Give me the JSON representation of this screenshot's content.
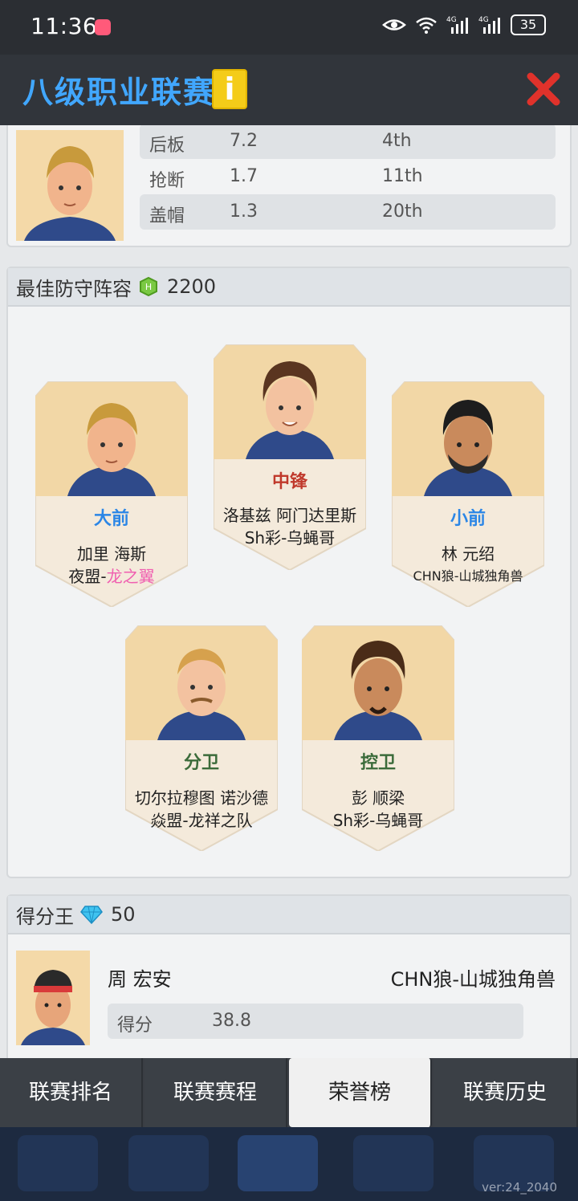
{
  "status_bar": {
    "time": "11:36",
    "battery": "35",
    "net1": "4G",
    "net2": "4G"
  },
  "header": {
    "title": "八级职业联赛",
    "info_label": "i"
  },
  "top_player": {
    "stats": [
      {
        "label": "后板",
        "value": "7.2",
        "rank": "4th"
      },
      {
        "label": "抢断",
        "value": "1.7",
        "rank": "11th"
      },
      {
        "label": "盖帽",
        "value": "1.3",
        "rank": "20th"
      }
    ]
  },
  "defense": {
    "title": "最佳防守阵容",
    "value": "2200",
    "players": [
      {
        "pos": "大前",
        "name": "加里 海斯",
        "team_prefix": "夜盟-",
        "team_highlight": "龙之翼"
      },
      {
        "pos": "中锋",
        "name": "洛基兹 阿门达里斯",
        "team": "Sh彩-乌蝇哥"
      },
      {
        "pos": "小前",
        "name": "林 元绍",
        "team": "CHN狼-山城独角兽"
      },
      {
        "pos": "分卫",
        "name": "切尔拉穆图 诺沙德",
        "team": "焱盟-龙祥之队"
      },
      {
        "pos": "控卫",
        "name": "彭 顺梁",
        "team": "Sh彩-乌蝇哥"
      }
    ]
  },
  "scoring": {
    "title": "得分王",
    "value": "50",
    "player": {
      "name": "周 宏安",
      "team": "CHN狼-山城独角兽",
      "stat_label": "得分",
      "stat_value": "38.8"
    }
  },
  "tabs": [
    "联赛排名",
    "联赛赛程",
    "荣誉榜",
    "联赛历史"
  ],
  "active_tab": "荣誉榜",
  "version": "ver:24_2040",
  "colors": {
    "title_blue": "#41a7ff",
    "accent_blue": "#2b86e6",
    "pink": "#f05fb0",
    "info_yellow": "#f4cc19",
    "close_red": "#e0322b"
  }
}
